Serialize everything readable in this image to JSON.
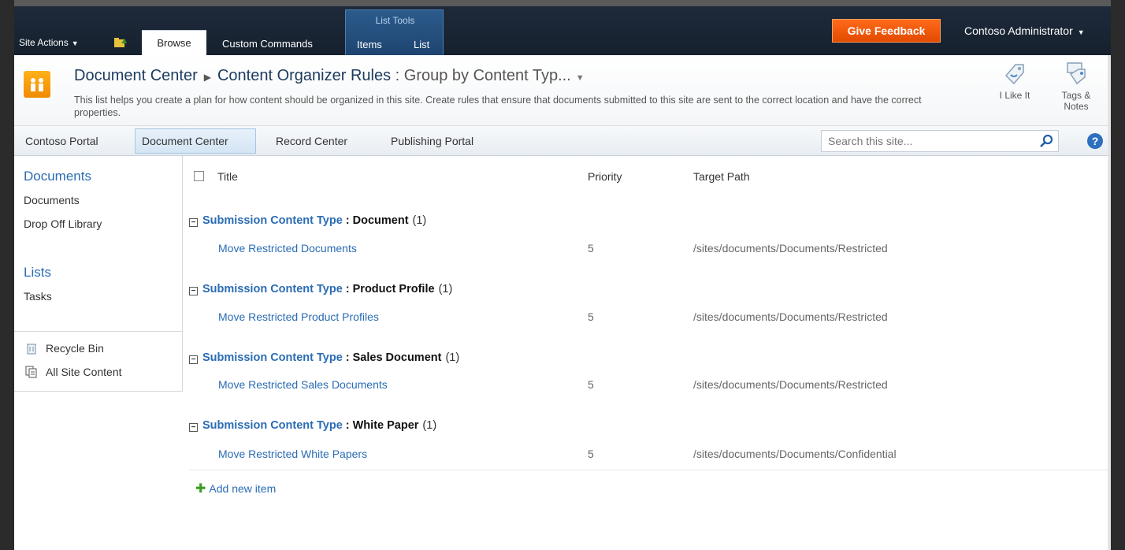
{
  "ribbon": {
    "site_actions": "Site Actions",
    "tabs": [
      {
        "label": "Browse",
        "selected": true
      },
      {
        "label": "Custom Commands",
        "selected": false
      }
    ],
    "list_tools": {
      "title": "List Tools",
      "tabs": [
        "Items",
        "List"
      ]
    },
    "give_feedback": "Give Feedback",
    "user": "Contoso Administrator"
  },
  "title_area": {
    "breadcrumb": [
      "Document Center",
      "Content Organizer Rules"
    ],
    "view": ": Group by Content Typ...",
    "description": "This list helps you create a plan for how content should be organized in this site.  Create rules that ensure that documents submitted to this site are sent to the correct location and have the correct properties.",
    "social": {
      "like": "I Like It",
      "tags": "Tags & Notes"
    }
  },
  "topnav": {
    "items": [
      "Contoso Portal",
      "Document Center",
      "Record Center",
      "Publishing Portal"
    ],
    "selected": "Document Center",
    "search_placeholder": "Search this site..."
  },
  "leftnav": {
    "documents_header": "Documents",
    "documents_items": [
      "Documents",
      "Drop Off Library"
    ],
    "lists_header": "Lists",
    "lists_items": [
      "Tasks"
    ],
    "recycle_bin": "Recycle Bin",
    "all_site_content": "All Site Content"
  },
  "list": {
    "columns": {
      "title": "Title",
      "priority": "Priority",
      "target_path": "Target Path"
    },
    "group_label": "Submission Content Type",
    "groups": [
      {
        "value": "Document",
        "count": "(1)",
        "rows": [
          {
            "title": "Move Restricted Documents",
            "priority": "5",
            "path": "/sites/documents/Documents/Restricted"
          }
        ]
      },
      {
        "value": "Product Profile",
        "count": "(1)",
        "rows": [
          {
            "title": "Move Restricted Product Profiles",
            "priority": "5",
            "path": "/sites/documents/Documents/Restricted"
          }
        ]
      },
      {
        "value": "Sales Document",
        "count": "(1)",
        "rows": [
          {
            "title": "Move Restricted Sales Documents",
            "priority": "5",
            "path": "/sites/documents/Documents/Restricted"
          }
        ]
      },
      {
        "value": "White Paper",
        "count": "(1)",
        "rows": [
          {
            "title": "Move Restricted White Papers",
            "priority": "5",
            "path": "/sites/documents/Documents/Confidential"
          }
        ]
      }
    ],
    "add_new_item": "Add new item"
  },
  "colors": {
    "ribbon_bg": "#1e2a3a",
    "feedback": "#f25a0a",
    "link": "#2a6cb4",
    "list_tools": "#2b5b8c"
  }
}
